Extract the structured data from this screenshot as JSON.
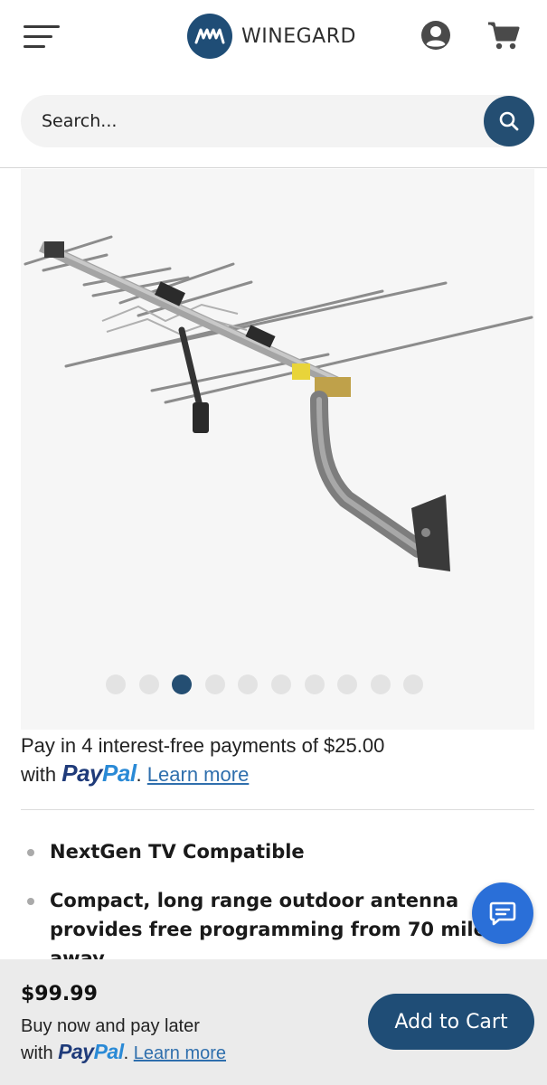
{
  "header": {
    "brand": "WINEGARD",
    "icons": {
      "menu": "hamburger-menu-icon",
      "account": "user-circle-icon",
      "cart": "shopping-cart-icon",
      "search": "magnifier-icon"
    }
  },
  "search": {
    "placeholder": "Search..."
  },
  "gallery": {
    "slide_count": 10,
    "active_slide": 3
  },
  "payin4": {
    "text": "Pay in 4 interest-free payments of $25.00",
    "with": "with",
    "paypal_pay": "Pay",
    "paypal_pal": "Pal",
    "period": ".",
    "learn_more": "Learn more"
  },
  "features": [
    "NextGen TV Compatible",
    "Compact, long range outdoor antenna provides free programming from 70 miles away"
  ],
  "bottom_bar": {
    "price": "$99.99",
    "buy_now_text": "Buy now and pay later",
    "with": "with",
    "paypal_pay": "Pay",
    "paypal_pal": "Pal",
    "period": ".",
    "learn_more": "Learn more",
    "add_to_cart": "Add to Cart"
  },
  "colors": {
    "brand_navy": "#1f4d76",
    "paypal_dark": "#1f3b7a",
    "paypal_light": "#2a8ad6",
    "chat_blue": "#2a6fd8",
    "link_blue": "#2f6fad"
  }
}
